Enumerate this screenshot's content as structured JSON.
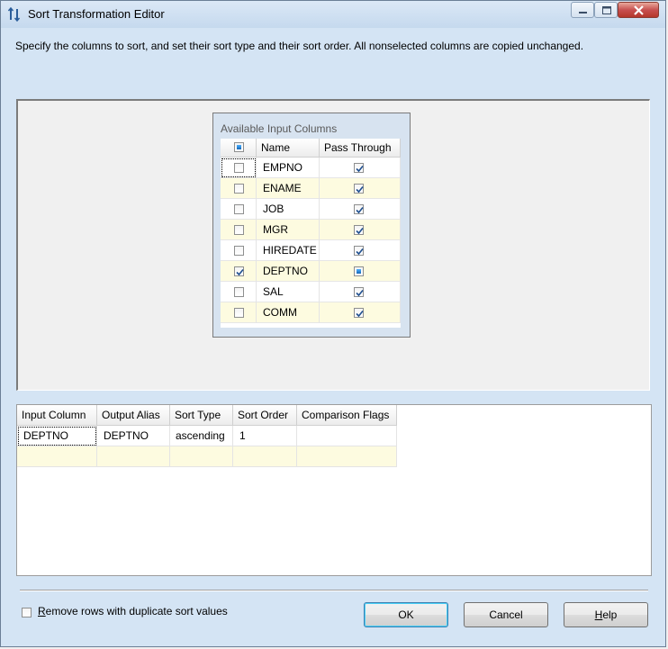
{
  "window": {
    "title": "Sort Transformation Editor"
  },
  "description": "Specify the columns to sort, and set their sort type and their sort order. All nonselected columns are copied unchanged.",
  "available_columns": {
    "title": "Available Input Columns",
    "headers": {
      "select_all": "",
      "name": "Name",
      "pass_through": "Pass Through"
    },
    "select_all_state": "indeterminate",
    "rows": [
      {
        "name": "EMPNO",
        "selected": false,
        "pass_through": "checked"
      },
      {
        "name": "ENAME",
        "selected": false,
        "pass_through": "checked"
      },
      {
        "name": "JOB",
        "selected": false,
        "pass_through": "checked"
      },
      {
        "name": "MGR",
        "selected": false,
        "pass_through": "checked"
      },
      {
        "name": "HIREDATE",
        "selected": false,
        "pass_through": "checked"
      },
      {
        "name": "DEPTNO",
        "selected": true,
        "pass_through": "indeterminate"
      },
      {
        "name": "SAL",
        "selected": false,
        "pass_through": "checked"
      },
      {
        "name": "COMM",
        "selected": false,
        "pass_through": "checked"
      }
    ]
  },
  "sort_grid": {
    "headers": {
      "input_column": "Input Column",
      "output_alias": "Output Alias",
      "sort_type": "Sort Type",
      "sort_order": "Sort Order",
      "comparison_flags": "Comparison Flags"
    },
    "rows": [
      {
        "input_column": "DEPTNO",
        "output_alias": "DEPTNO",
        "sort_type": "ascending",
        "sort_order": "1",
        "comparison_flags": ""
      },
      {
        "input_column": "",
        "output_alias": "",
        "sort_type": "",
        "sort_order": "",
        "comparison_flags": ""
      }
    ]
  },
  "options": {
    "remove_duplicates_label": "Remove rows with duplicate sort values",
    "remove_duplicates_checked": false
  },
  "buttons": {
    "ok": "OK",
    "cancel": "Cancel",
    "help": "Help"
  },
  "colors": {
    "alt_row": "#fdfbe0",
    "check_blue": "#1f4f8f",
    "close_red": "#c75050"
  }
}
